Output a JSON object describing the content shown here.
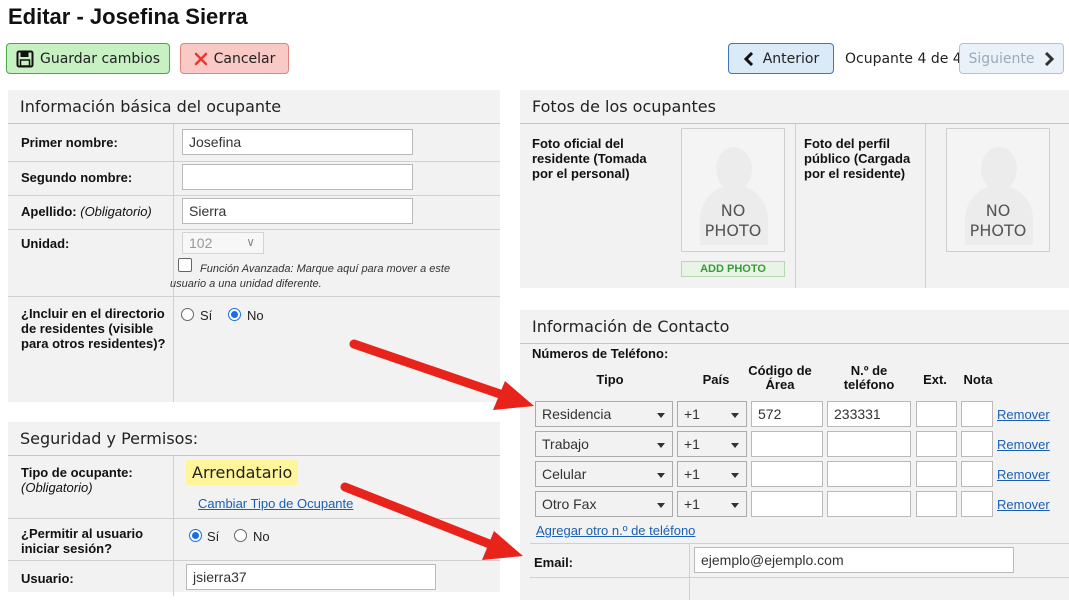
{
  "page": {
    "title": "Editar - Josefina Sierra"
  },
  "toolbar": {
    "save_label": "Guardar cambios",
    "cancel_label": "Cancelar",
    "prev_label": "Anterior",
    "occupant_count": "Ocupante 4 de 4",
    "next_label": "Siguiente"
  },
  "basic_info": {
    "heading": "Información básica del ocupante",
    "first_name_label": "Primer nombre:",
    "first_name_value": "Josefina",
    "middle_name_label": "Segundo nombre:",
    "middle_name_value": "",
    "last_name_label": "Apellido:",
    "last_name_required": "(Obligatorio)",
    "last_name_value": "Sierra",
    "unit_label": "Unidad:",
    "unit_value": "102",
    "advanced_note": "Función Avanzada: Marque aquí para mover a este usuario a una unidad diferente.",
    "directory_label": "¿Incluir en el directorio de residentes (visible para otros residentes)?",
    "yes_label": "Sí",
    "no_label": "No",
    "directory_selected": "No"
  },
  "security": {
    "heading": "Seguridad y Permisos:",
    "type_label": "Tipo de ocupante:",
    "type_required": "(Obligatorio)",
    "type_value": "Arrendatario",
    "change_type_link": "Cambiar Tipo de Ocupante",
    "login_label": "¿Permitir al usuario iniciar sesión?",
    "yes_label": "Sí",
    "no_label": "No",
    "login_selected": "Sí",
    "user_label": "Usuario:",
    "user_value": "jsierra37"
  },
  "photos": {
    "heading": "Fotos de los ocupantes",
    "official_label": "Foto oficial del residente (Tomada por el personal)",
    "profile_label": "Foto del perfil público (Cargada por el residente)",
    "no_photo_line1": "NO",
    "no_photo_line2": "PHOTO",
    "add_photo_label": "ADD PHOTO"
  },
  "contact": {
    "heading": "Información de Contacto",
    "phones_label": "Números de Teléfono:",
    "columns": {
      "type": "Tipo",
      "country": "País",
      "area": "Código de Área",
      "number": "N.º de teléfono",
      "ext": "Ext.",
      "note": "Nota"
    },
    "phones": [
      {
        "type": "Residencia",
        "country": "+1",
        "area": "572",
        "number": "233331",
        "ext": "",
        "note": "",
        "remove": "Remover"
      },
      {
        "type": "Trabajo",
        "country": "+1",
        "area": "",
        "number": "",
        "ext": "",
        "note": "",
        "remove": "Remover"
      },
      {
        "type": "Celular",
        "country": "+1",
        "area": "",
        "number": "",
        "ext": "",
        "note": "",
        "remove": "Remover"
      },
      {
        "type": "Otro Fax",
        "country": "+1",
        "area": "",
        "number": "",
        "ext": "",
        "note": "",
        "remove": "Remover"
      }
    ],
    "add_phone_link": "Agregar otro n.º de teléfono",
    "email_label": "Email:",
    "email_value": "ejemplo@ejemplo.com"
  },
  "annotation": {
    "arrow_color": "#e8231c"
  },
  "colors": {
    "save_bg": "#c7f0c3",
    "cancel_bg": "#f8c9c5",
    "nav_bg": "#dbeaf8",
    "radio_accent": "#1a6ee0",
    "highlight": "#fff59a",
    "link": "#1a5fb4"
  }
}
